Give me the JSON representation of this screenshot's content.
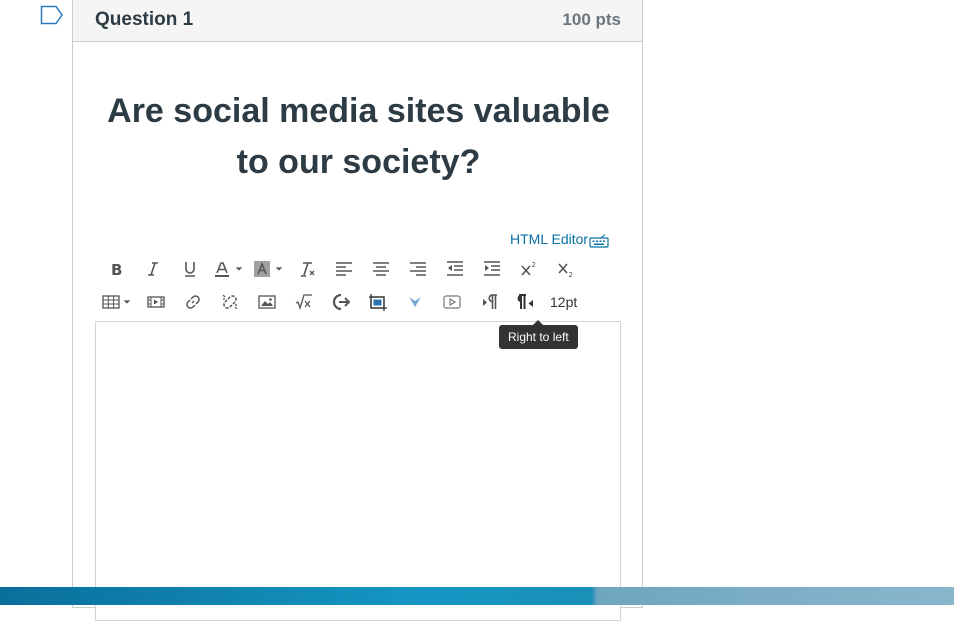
{
  "question": {
    "name": "Question 1",
    "points": "100 pts",
    "text": "Are social media sites valuable to our society?"
  },
  "editor": {
    "html_editor_label": "HTML Editor",
    "font_size": "12pt",
    "tooltip": "Right to left",
    "toolbar_row1": [
      "bold-icon",
      "italic-icon",
      "underline-icon",
      "text-color-icon",
      "background-color-icon",
      "clear-formatting-icon",
      "align-left-icon",
      "align-center-icon",
      "align-right-icon",
      "outdent-icon",
      "indent-icon",
      "superscript-icon",
      "subscript-icon"
    ],
    "toolbar_row2": [
      "table-icon",
      "media-icon",
      "link-icon",
      "unlink-icon",
      "image-icon",
      "math-equation-icon",
      "embed-icon",
      "upload-image-icon",
      "apps-icon",
      "record-media-icon",
      "left-to-right-icon",
      "right-to-left-icon"
    ]
  },
  "colors": {
    "link": "#0770a3",
    "text": "#2d3b45",
    "header_bg": "#f5f5f5",
    "tooltip_bg": "#333333"
  }
}
